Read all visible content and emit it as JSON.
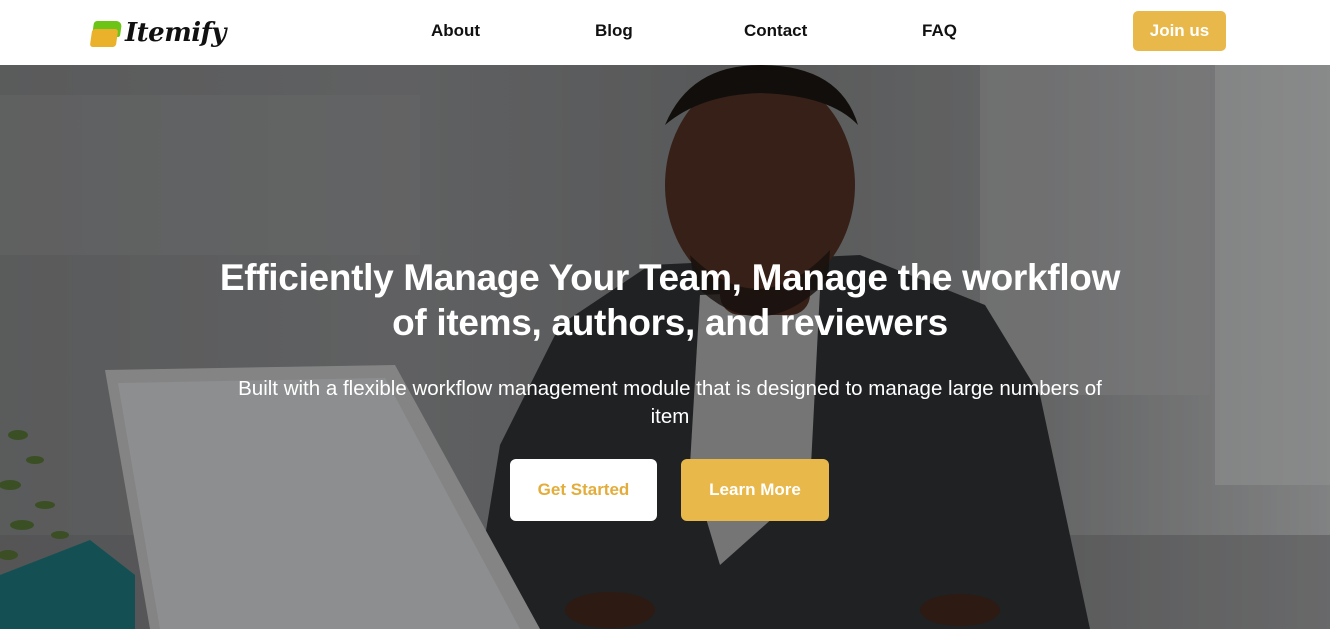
{
  "brand": {
    "name": "Itemify"
  },
  "nav": {
    "about": "About",
    "blog": "Blog",
    "contact": "Contact",
    "faq": "FAQ"
  },
  "header": {
    "join_label": "Join us"
  },
  "hero": {
    "title_line1": "Efficiently Manage Your Team, Manage the workflow",
    "title_line2": "of items, authors, and reviewers",
    "subtitle_line1": "Built with a flexible workflow management module that is designed to manage large numbers of",
    "subtitle_line2": "item",
    "get_started_label": "Get Started",
    "learn_more_label": "Learn More"
  },
  "colors": {
    "accent": "#e8b84a",
    "accent_text": "#e3ad3c",
    "logo_green": "#6cc417",
    "logo_yellow": "#e9b22a",
    "nav_text": "#111111",
    "hero_text": "#ffffff"
  }
}
